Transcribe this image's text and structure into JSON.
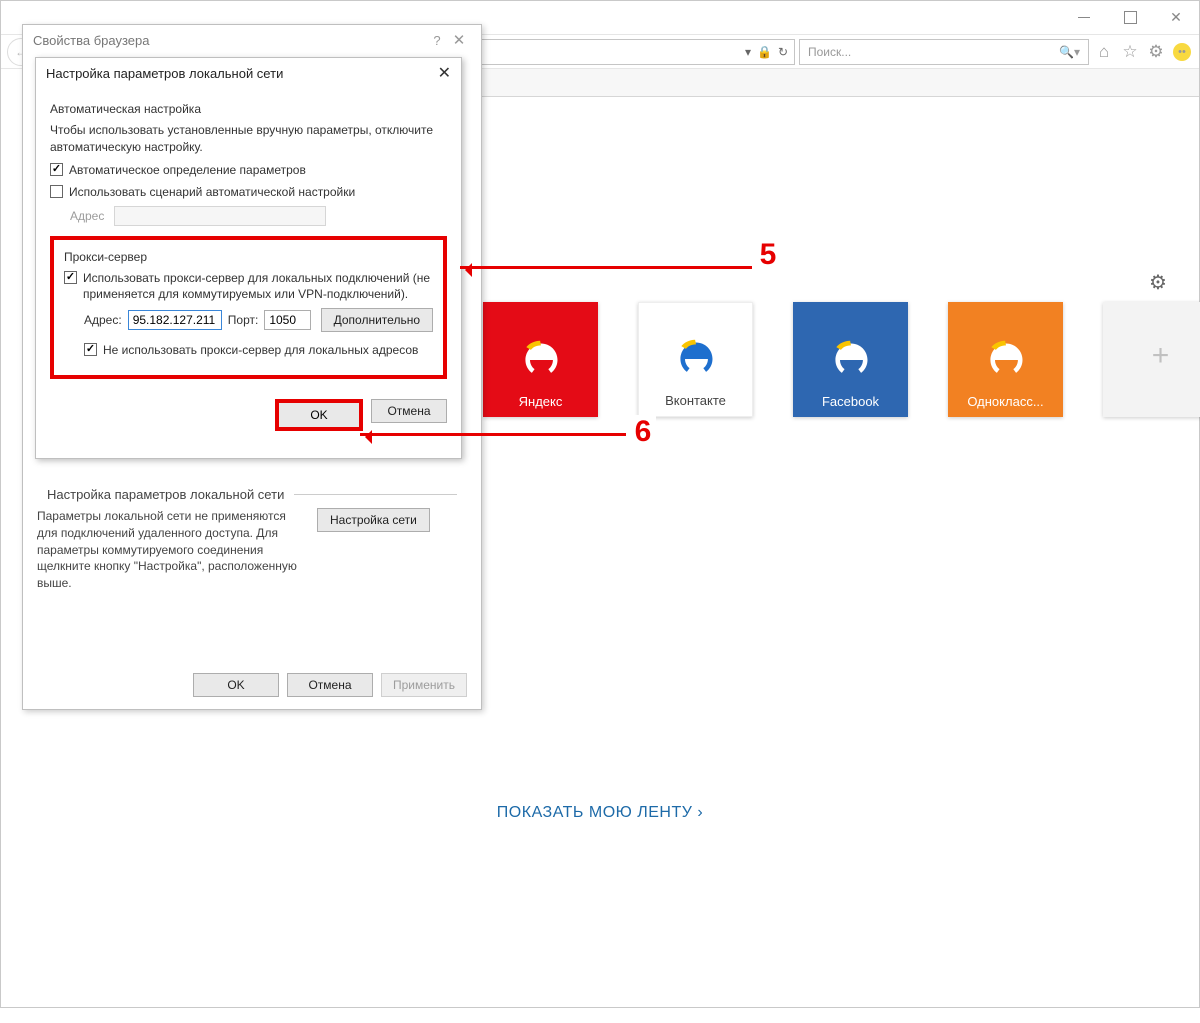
{
  "window": {
    "minimize": "—",
    "maximize": "□",
    "close": "✕"
  },
  "toolbar": {
    "search_placeholder": "Поиск..."
  },
  "tiles": [
    {
      "label": "Яндекс",
      "color": "red"
    },
    {
      "label": "Вконтакте",
      "color": "white"
    },
    {
      "label": "Facebook",
      "color": "blue"
    },
    {
      "label": "Однокласс...",
      "color": "orange"
    }
  ],
  "feed_link": "ПОКАЗАТЬ МОЮ ЛЕНТУ",
  "props_dialog": {
    "title": "Свойства браузера",
    "lan_section": "Настройка параметров локальной сети",
    "lan_desc": "Параметры локальной сети не применяются для подключений удаленного доступа. Для параметры коммутируемого соединения щелкните кнопку \"Настройка\", расположенную выше.",
    "lan_btn": "Настройка сети",
    "ok": "OK",
    "cancel": "Отмена",
    "apply": "Применить"
  },
  "lan_dialog": {
    "title": "Настройка параметров локальной сети",
    "auto_section": "Автоматическая настройка",
    "auto_note": "Чтобы использовать установленные вручную параметры, отключите автоматическую настройку.",
    "auto_detect": "Автоматическое определение параметров",
    "use_script": "Использовать сценарий автоматической настройки",
    "address_label": "Адрес",
    "proxy_section": "Прокси-сервер",
    "use_proxy": "Использовать прокси-сервер для локальных подключений (не применяется для коммутируемых или VPN-подключений).",
    "address": "Адрес:",
    "address_value": "95.182.127.211",
    "port": "Порт:",
    "port_value": "1050",
    "advanced": "Дополнительно",
    "bypass_local": "Не использовать прокси-сервер для локальных адресов",
    "ok": "OK",
    "cancel": "Отмена"
  },
  "annotations": {
    "five": "5",
    "six": "6"
  }
}
